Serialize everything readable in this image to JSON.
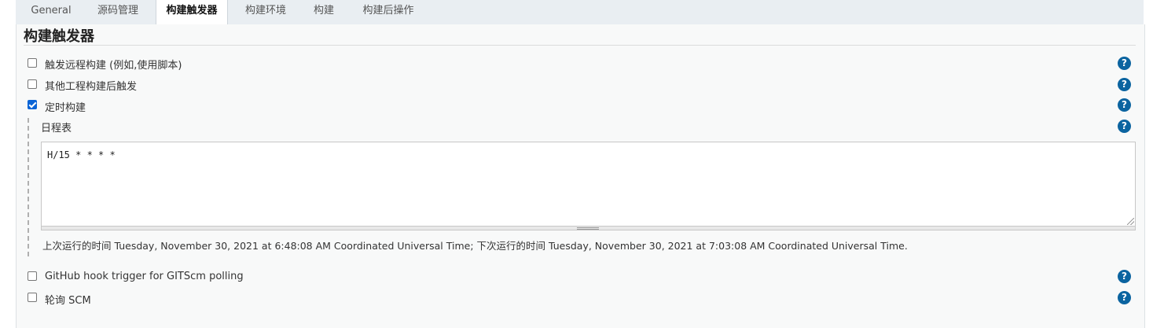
{
  "tabs": [
    {
      "label": "General",
      "active": false
    },
    {
      "label": "源码管理",
      "active": false
    },
    {
      "label": "构建触发器",
      "active": true
    },
    {
      "label": "构建环境",
      "active": false
    },
    {
      "label": "构建",
      "active": false
    },
    {
      "label": "构建后操作",
      "active": false
    }
  ],
  "section": {
    "title": "构建触发器",
    "triggers": [
      {
        "label": "触发远程构建 (例如,使用脚本)",
        "checked": false
      },
      {
        "label": "其他工程构建后触发",
        "checked": false
      },
      {
        "label": "定时构建",
        "checked": true
      },
      {
        "label": "GitHub hook trigger for GITScm polling",
        "checked": false
      },
      {
        "label": "轮询 SCM",
        "checked": false
      }
    ],
    "schedule": {
      "label": "日程表",
      "value": "H/15 * * * *",
      "info": "上次运行的时间 Tuesday, November 30, 2021 at 6:48:08 AM Coordinated Universal Time; 下次运行的时间 Tuesday, November 30, 2021 at 7:03:08 AM Coordinated Universal Time."
    }
  },
  "help_icon": "question-circle-icon",
  "help_glyph": "?",
  "colors": {
    "accent": "#0b64a0",
    "checkbox_checked": "#0a64d6"
  }
}
